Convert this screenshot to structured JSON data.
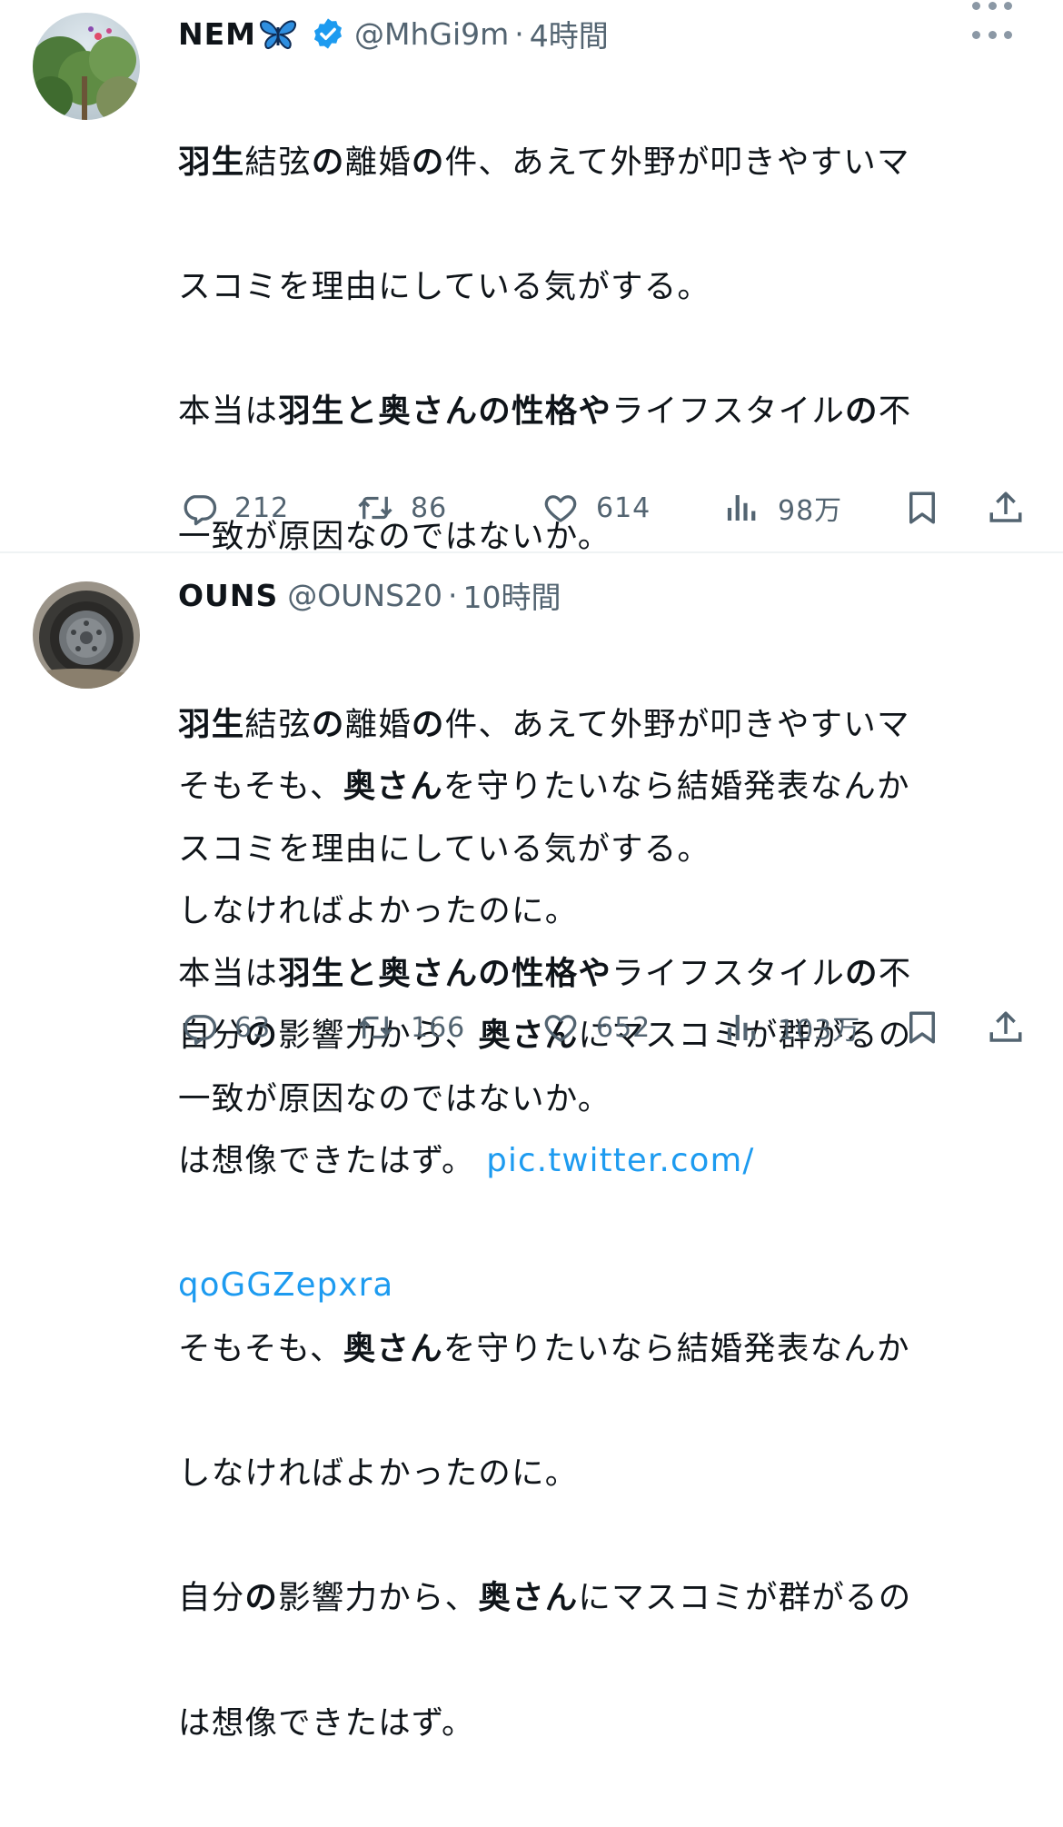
{
  "tweets": [
    {
      "name": "NEM",
      "name_emoji": "🦋",
      "verified": true,
      "handle": "@MhGi9m",
      "separator": "·",
      "time": "4時間",
      "lines": [
        [
          "羽生",
          "結弦",
          "の",
          "離婚",
          "の",
          "件、あえて外野が叩きやすいマ"
        ],
        [
          "スコミを理由にしている気がする。"
        ],
        [
          "本当は",
          "羽生と奥さんの性格や",
          "ライフスタイル",
          "の",
          "不"
        ],
        [
          "一致が原因なのではないか。"
        ],
        [
          ""
        ],
        [
          "そもそも、",
          "奥さん",
          "を守りたいなら結婚発表なんか"
        ],
        [
          "しなければよかったのに。"
        ],
        [
          "自分",
          "の",
          "影響力から、",
          "奥さん",
          "にマスコミが群がるの"
        ],
        [
          "は想像できたはず。 "
        ],
        [
          ""
        ]
      ],
      "link_part1": "pic.twitter.com/",
      "link_part2": "qoGGZepxra",
      "replies": "212",
      "retweets": "86",
      "likes": "614",
      "views": "98万"
    },
    {
      "name": "OUNS",
      "handle": "@OUNS20",
      "separator": "·",
      "time": "10時間",
      "lines": [
        [
          "羽生",
          "結弦",
          "の",
          "離婚",
          "の",
          "件、あえて外野が叩きやすいマ"
        ],
        [
          "スコミを理由にしている気がする。"
        ],
        [
          "本当は",
          "羽生と奥さんの性格や",
          "ライフスタイル",
          "の",
          "不"
        ],
        [
          "一致が原因なのではないか。"
        ],
        [
          ""
        ],
        [
          "そもそも、",
          "奥さん",
          "を守りたいなら結婚発表なんか"
        ],
        [
          "しなければよかったのに。"
        ],
        [
          "自分",
          "の",
          "影響力から、",
          "奥さん",
          "にマスコミが群がるの"
        ],
        [
          "は想像できたはず。"
        ]
      ],
      "replies": "63",
      "retweets": "166",
      "likes": "652",
      "views": "103万"
    }
  ],
  "colors": {
    "text": "#0f1419",
    "secondary": "#536471",
    "link": "#1d9bf0",
    "verified": "#1d9bf0"
  },
  "icons": [
    "more-icon",
    "reply-icon",
    "retweet-icon",
    "like-icon",
    "views-icon",
    "bookmark-icon",
    "share-icon",
    "verified-badge-icon",
    "butterfly-emoji-icon"
  ]
}
